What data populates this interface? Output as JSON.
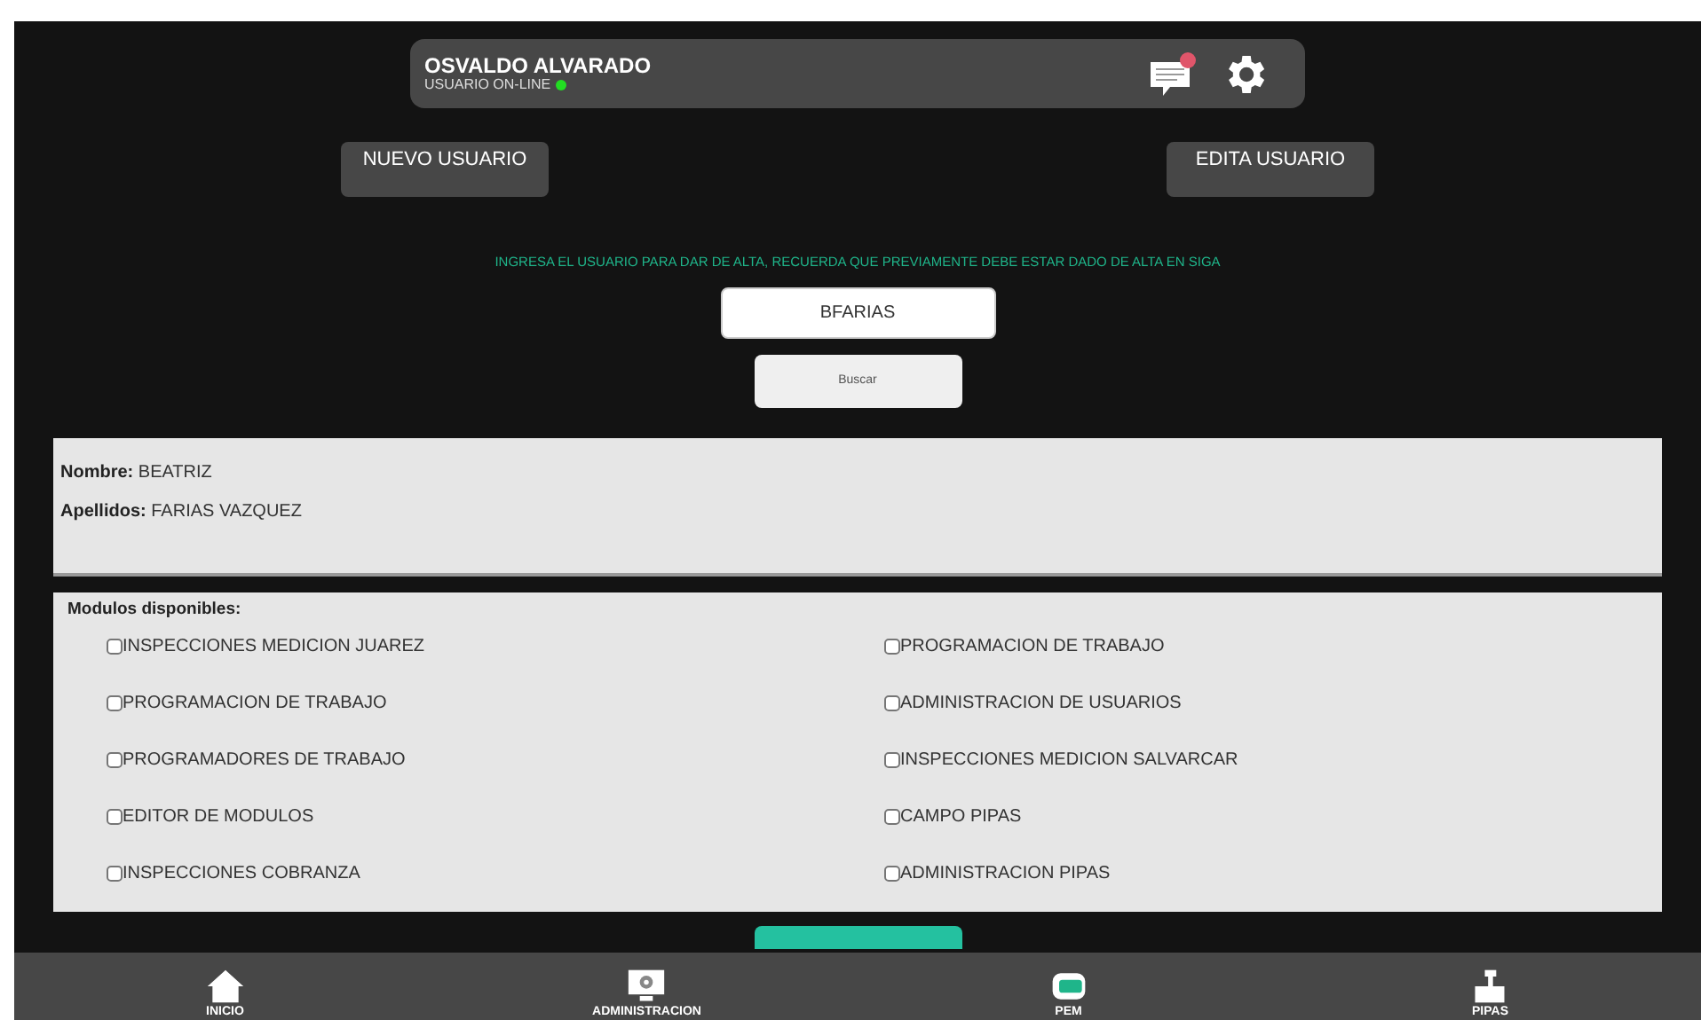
{
  "header": {
    "user_name": "OSVALDO ALVARADO",
    "status": "USUARIO ON-LINE",
    "online": true,
    "notification": true
  },
  "actions": [
    "NUEVO USUARIO",
    "EDITA USUARIO"
  ],
  "instruction": "INGRESA EL USUARIO PARA DAR DE ALTA, RECUERDA QUE PREVIAMENTE DEBE ESTAR DADO DE ALTA EN SIGA",
  "search": {
    "value": "BFARIAS",
    "button": "Buscar"
  },
  "user_info": [
    {
      "label": "Nombre:",
      "value": "BEATRIZ"
    },
    {
      "label": "Apellidos:",
      "value": "FARIAS VAZQUEZ"
    }
  ],
  "modules": {
    "title": "Modulos disponibles:",
    "items": [
      {
        "label": "INSPECCIONES MEDICION JUAREZ",
        "checked": false
      },
      {
        "label": "PROGRAMACION DE TRABAJO",
        "checked": false
      },
      {
        "label": "PROGRAMACION DE TRABAJO",
        "checked": false
      },
      {
        "label": "ADMINISTRACION DE USUARIOS",
        "checked": false
      },
      {
        "label": "PROGRAMADORES DE TRABAJO",
        "checked": false
      },
      {
        "label": "INSPECCIONES MEDICION SALVARCAR",
        "checked": false
      },
      {
        "label": "EDITOR DE MODULOS",
        "checked": false
      },
      {
        "label": "CAMPO PIPAS",
        "checked": false
      },
      {
        "label": "INSPECCIONES COBRANZA",
        "checked": false
      },
      {
        "label": "ADMINISTRACION PIPAS",
        "checked": false
      }
    ]
  },
  "nav": [
    {
      "label": "INICIO",
      "kind": "home"
    },
    {
      "label": "ADMINISTRACION",
      "kind": "admin"
    },
    {
      "label": "PEM",
      "kind": "pem"
    },
    {
      "label": "PIPAS",
      "kind": "pipas"
    }
  ]
}
